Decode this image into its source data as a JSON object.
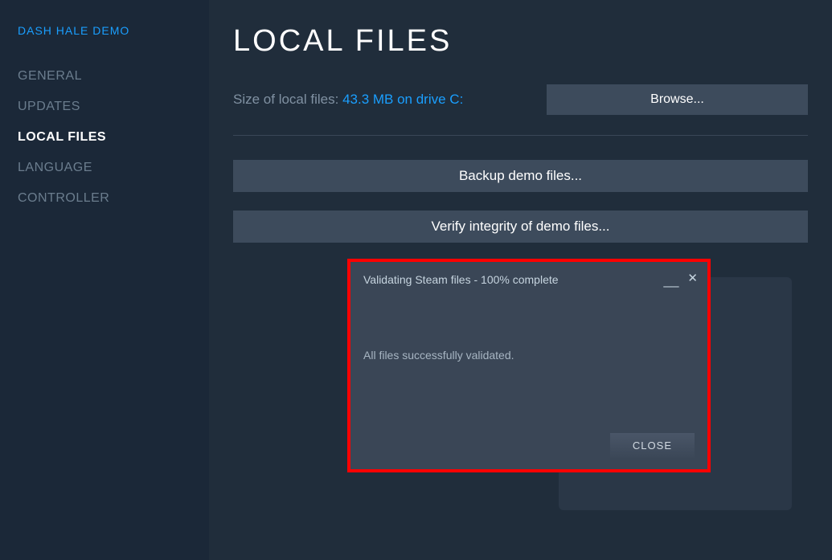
{
  "sidebar": {
    "game_title": "DASH HALE DEMO",
    "items": [
      {
        "label": "GENERAL",
        "active": false
      },
      {
        "label": "UPDATES",
        "active": false
      },
      {
        "label": "LOCAL FILES",
        "active": true
      },
      {
        "label": "LANGUAGE",
        "active": false
      },
      {
        "label": "CONTROLLER",
        "active": false
      }
    ]
  },
  "main": {
    "title": "LOCAL FILES",
    "size_label": "Size of local files: ",
    "size_value": "43.3 MB on drive C:",
    "browse_label": "Browse...",
    "backup_label": "Backup demo files...",
    "verify_label": "Verify integrity of demo files..."
  },
  "dialog": {
    "title": "Validating Steam files - 100% complete",
    "message": "All files successfully validated.",
    "close_label": "CLOSE"
  }
}
